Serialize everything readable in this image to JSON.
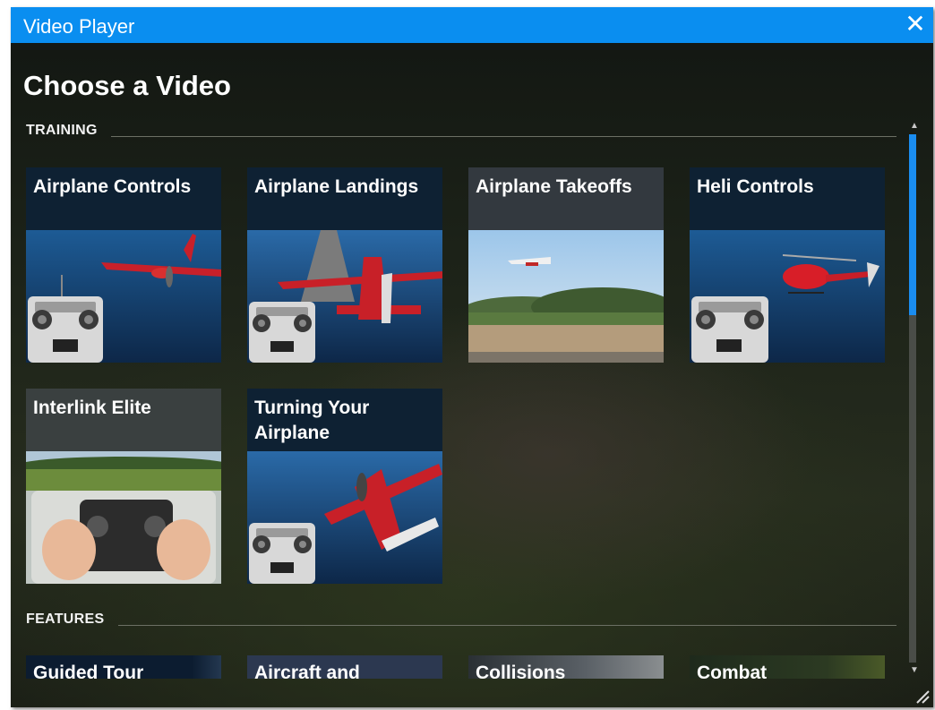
{
  "window": {
    "title": "Video Player",
    "close_icon": "close-icon"
  },
  "main": {
    "heading": "Choose a Video",
    "sections": [
      {
        "label": "TRAINING",
        "videos": [
          {
            "title": "Airplane Controls"
          },
          {
            "title": "Airplane Landings"
          },
          {
            "title": "Airplane Takeoffs"
          },
          {
            "title": "Heli Controls"
          },
          {
            "title": "Interlink Elite"
          },
          {
            "title": "Turning Your Airplane"
          }
        ]
      },
      {
        "label": "FEATURES",
        "videos": [
          {
            "title": "Guided Tour"
          },
          {
            "title": "Aircraft and"
          },
          {
            "title": "Collisions"
          },
          {
            "title": "Combat"
          }
        ]
      }
    ]
  },
  "colors": {
    "titlebar": "#0a8ef0",
    "scroll_thumb": "#1a8df0",
    "tile_caption": "#0e2133"
  }
}
